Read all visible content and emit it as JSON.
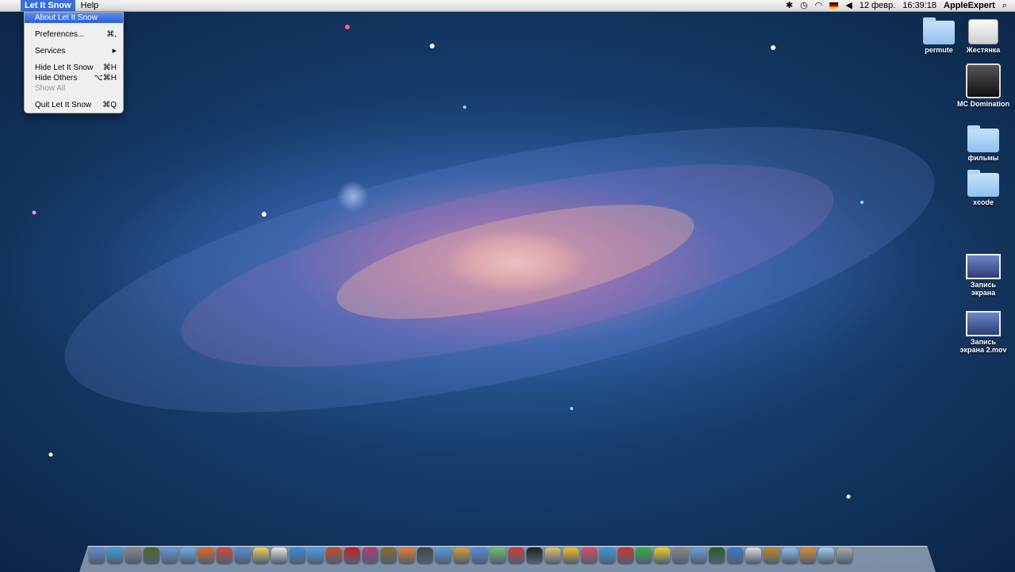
{
  "menubar": {
    "app_name": "Let It Snow",
    "menus": [
      "Help"
    ],
    "status": {
      "date": "12 февр.",
      "time": "16:39:18",
      "user": "AppleExpert"
    }
  },
  "app_menu": {
    "items": [
      {
        "label": "About Let It Snow",
        "shortcut": "",
        "state": "selected"
      },
      {
        "label": "Preferences...",
        "shortcut": "⌘,",
        "state": "normal"
      },
      {
        "label": "Services",
        "shortcut": "▶",
        "state": "normal"
      },
      {
        "label": "Hide Let It Snow",
        "shortcut": "⌘H",
        "state": "normal"
      },
      {
        "label": "Hide Others",
        "shortcut": "⌥⌘H",
        "state": "normal"
      },
      {
        "label": "Show All",
        "shortcut": "",
        "state": "disabled"
      },
      {
        "label": "Quit Let It Snow",
        "shortcut": "⌘Q",
        "state": "normal"
      }
    ]
  },
  "desktop": {
    "icons": [
      {
        "label": "permute",
        "kind": "folder"
      },
      {
        "label": "Жестянка",
        "kind": "drive"
      },
      {
        "label": "MC Domination",
        "kind": "app"
      },
      {
        "label": "фильмы",
        "kind": "folder"
      },
      {
        "label": "xcode",
        "kind": "folder"
      },
      {
        "label": "Запись экрана",
        "kind": "movie"
      },
      {
        "label": "Запись экрана 2.mov",
        "kind": "movie"
      }
    ]
  },
  "dock": {
    "icon_colors": [
      "#5a8fd8",
      "#3aa0e8",
      "#888",
      "#4a6a2a",
      "#6a9ae0",
      "#6cb0e8",
      "#e06a2a",
      "#d04a3a",
      "#5a8ad8",
      "#f0d060",
      "#e8e8e8",
      "#3a8ae0",
      "#4aa0f0",
      "#c84a2a",
      "#c82020",
      "#b03a7a",
      "#8a6a2a",
      "#f07a2a",
      "#444",
      "#5a9ae0",
      "#d0a030",
      "#5a8ae0",
      "#70c070",
      "#d03a3a",
      "#222",
      "#e0c070",
      "#f0c020",
      "#e04a6a",
      "#3a9ae0",
      "#d03030",
      "#30b040",
      "#f0d020",
      "#888",
      "#6aa0e0",
      "#2a5a2a",
      "#3a7ad0",
      "#ddd",
      "#c08a2a",
      "#8ac0f0",
      "#e08a3a",
      "#a0d0f0",
      "#aaa"
    ]
  }
}
